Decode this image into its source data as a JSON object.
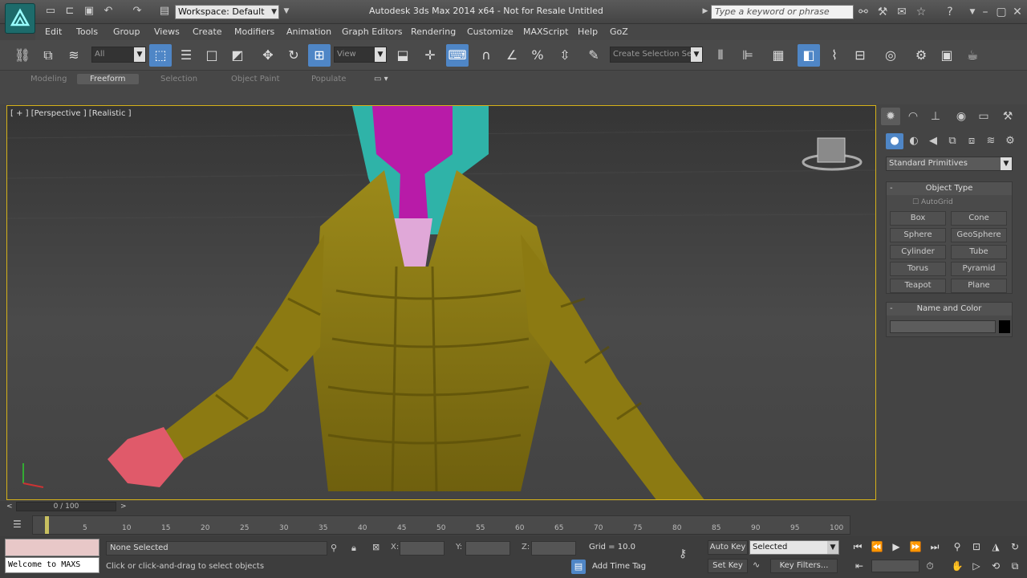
{
  "window": {
    "title": "Autodesk 3ds Max 2014 x64 - Not for Resale   Untitled",
    "workspace": "Workspace: Default",
    "search_placeholder": "Type a keyword or phrase"
  },
  "menus": [
    "Edit",
    "Tools",
    "Group",
    "Views",
    "Create",
    "Modifiers",
    "Animation",
    "Graph Editors",
    "Rendering",
    "Customize",
    "MAXScript",
    "Help",
    "GoZ"
  ],
  "toolbar": {
    "selection_filter": "All",
    "ref_coord": "View",
    "named_selection": "Create Selection Se"
  },
  "ribbon_tabs": [
    "Modeling",
    "Freeform",
    "Selection",
    "Object Paint",
    "Populate"
  ],
  "viewport": {
    "label": "[ + ] [Perspective ] [Realistic ]"
  },
  "command_panel": {
    "category": "Standard Primitives",
    "object_type": {
      "title": "Object Type",
      "autogrid": "AutoGrid",
      "buttons": [
        "Box",
        "Cone",
        "Sphere",
        "GeoSphere",
        "Cylinder",
        "Tube",
        "Torus",
        "Pyramid",
        "Teapot",
        "Plane"
      ]
    },
    "name_color": {
      "title": "Name and Color"
    }
  },
  "timeline": {
    "slider": "0 / 100",
    "ticks": [
      "5",
      "10",
      "15",
      "20",
      "25",
      "30",
      "35",
      "40",
      "45",
      "50",
      "55",
      "60",
      "65",
      "70",
      "75",
      "80",
      "85",
      "90",
      "95",
      "100"
    ]
  },
  "status": {
    "welcome": "Welcome to MAXS",
    "selection": "None Selected",
    "prompt": "Click or click-and-drag to select objects",
    "x_label": "X:",
    "y_label": "Y:",
    "z_label": "Z:",
    "grid": "Grid = 10.0",
    "add_time_tag": "Add Time Tag",
    "auto_key": "Auto Key",
    "set_key": "Set Key",
    "key_mode": "Selected",
    "key_filters": "Key Filters..."
  },
  "colors": {
    "accent": "#4f86c6",
    "viewport_border": "#d6b21a",
    "jacket": "#8c7a12",
    "skin_head": "#b81ba8",
    "hood": "#2fb3a8",
    "hand": "#e05a6a"
  }
}
